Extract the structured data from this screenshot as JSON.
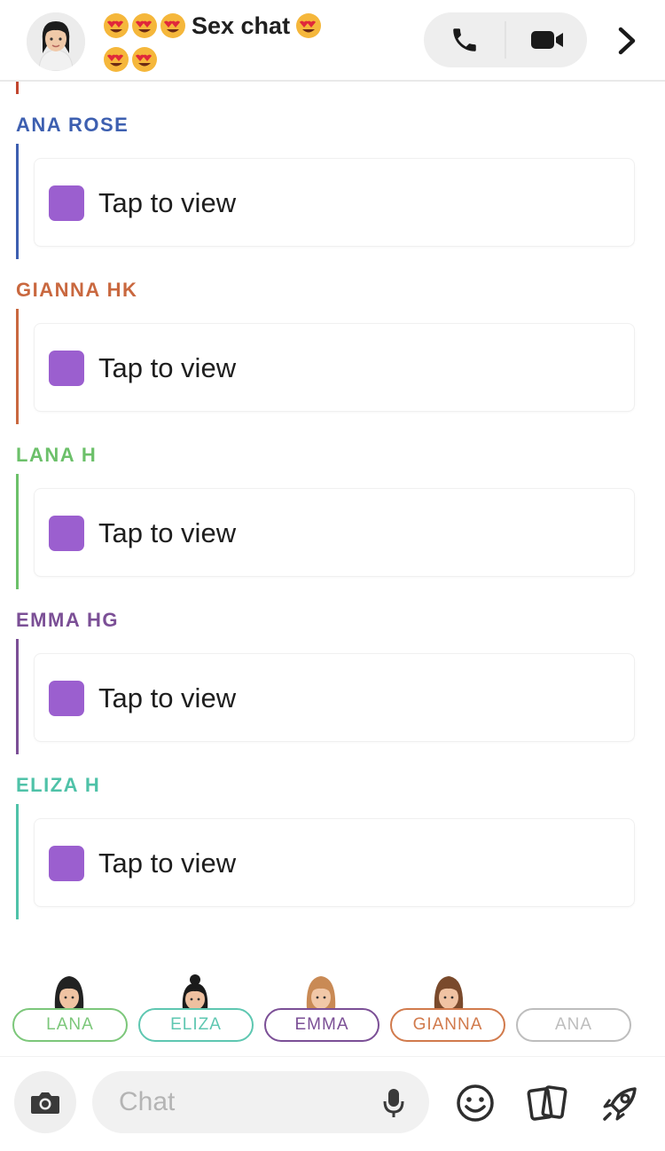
{
  "header": {
    "title": "Sex chat",
    "avatar_icon": "bitmoji-avatar",
    "emoji_icon": "heart-eyes-emoji",
    "call_icon": "phone-icon",
    "video_icon": "video-camera-icon",
    "more_icon": "chevron-right-icon"
  },
  "messages": [
    {
      "sender": "ANA ROSE",
      "color": "#3d5fb0",
      "text": "Tap to view"
    },
    {
      "sender": "GIANNA HK",
      "color": "#c9683f",
      "text": "Tap to view"
    },
    {
      "sender": "LANA H",
      "color": "#6cc06a",
      "text": "Tap to view"
    },
    {
      "sender": "EMMA HG",
      "color": "#7b4f96",
      "text": "Tap to view"
    },
    {
      "sender": "ELIZA H",
      "color": "#4fc2a8",
      "text": "Tap to view"
    }
  ],
  "snap_color": "#9b5fcf",
  "participants": [
    {
      "name": "LANA",
      "color": "#7cc77a"
    },
    {
      "name": "ELIZA",
      "color": "#5ec7b1"
    },
    {
      "name": "EMMA",
      "color": "#7b4f96"
    },
    {
      "name": "GIANNA",
      "color": "#d17a4c"
    },
    {
      "name": "ANA",
      "color": "#bdbdbd"
    }
  ],
  "composer": {
    "placeholder": "Chat",
    "camera_icon": "camera-icon",
    "mic_icon": "microphone-icon",
    "emoji_icon": "smiley-icon",
    "stickers_icon": "cards-icon",
    "games_icon": "rocket-icon"
  }
}
